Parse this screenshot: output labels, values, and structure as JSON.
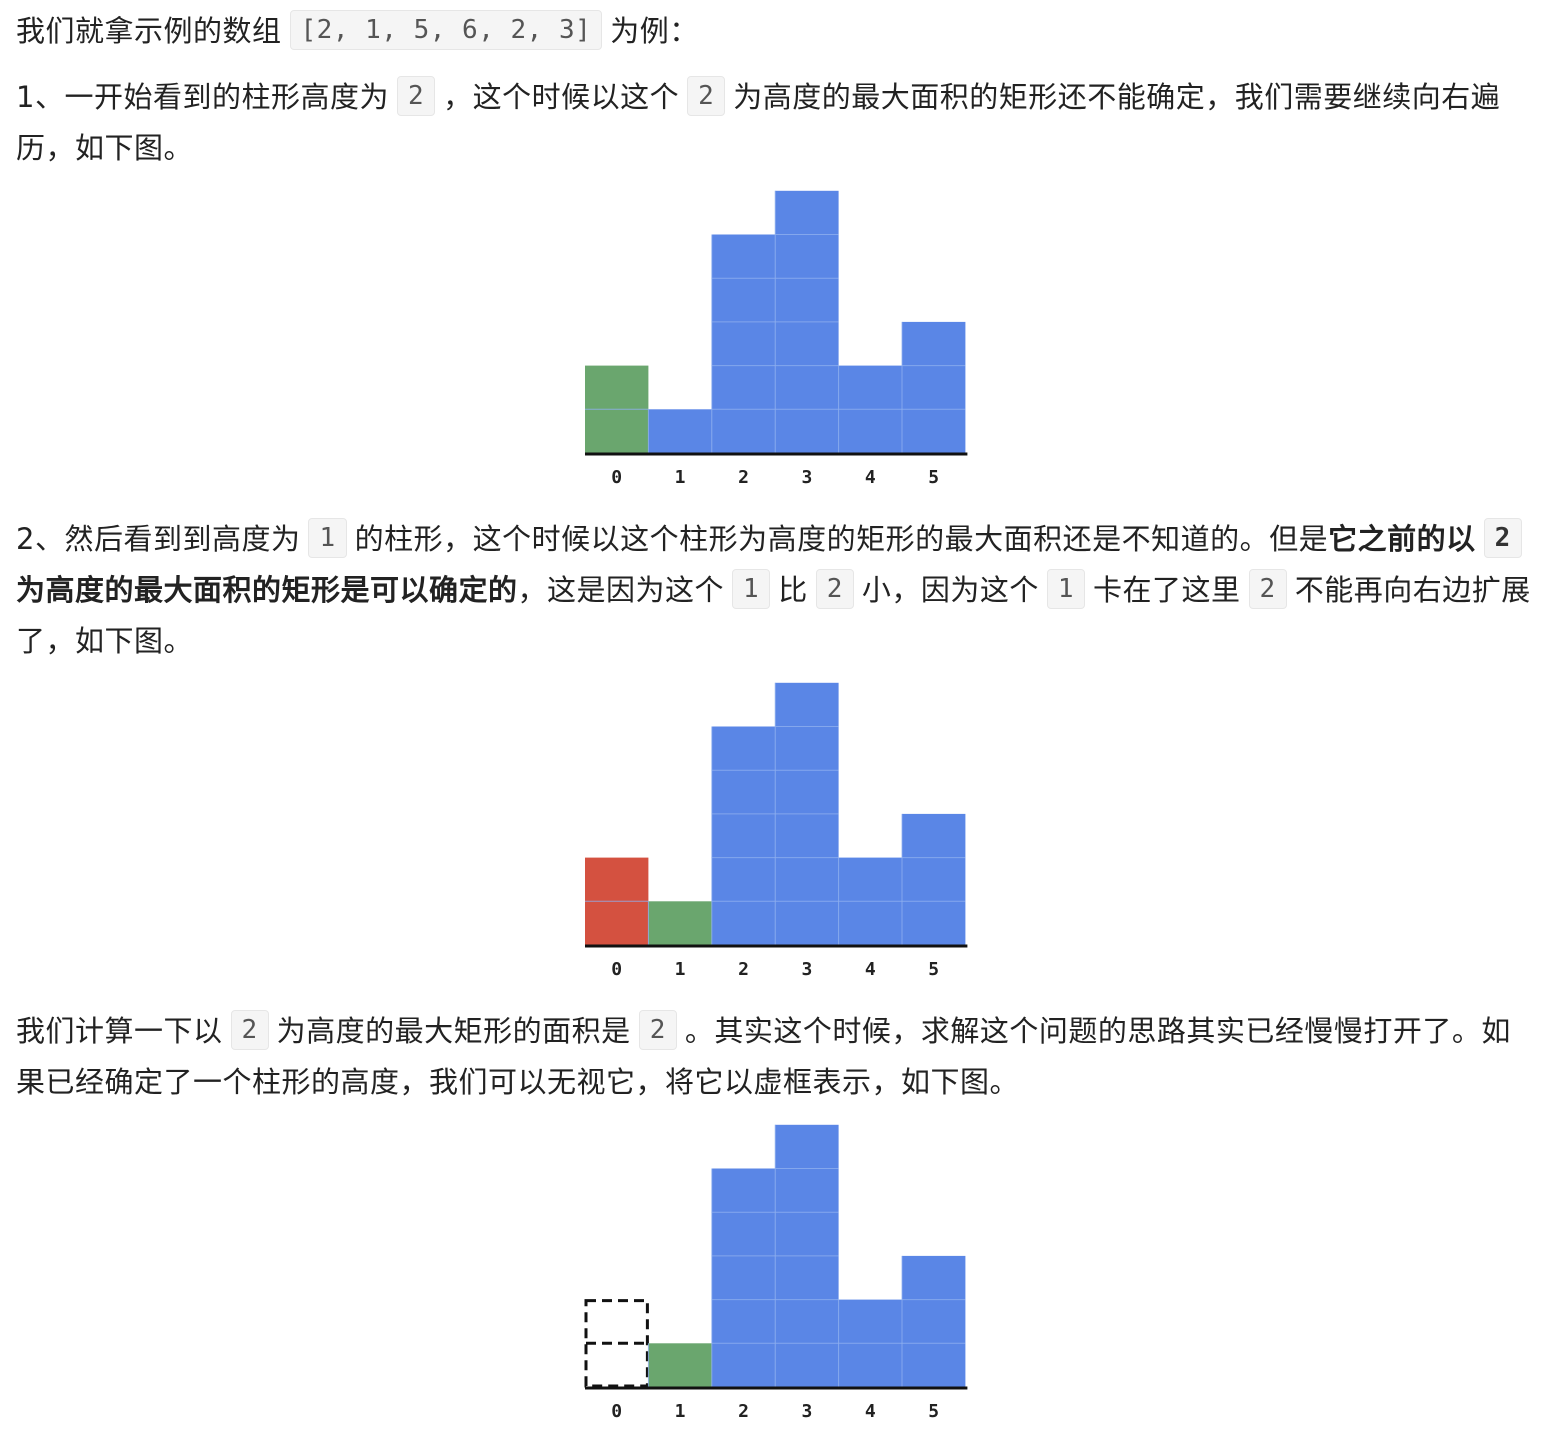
{
  "intro": {
    "text_before": "我们就拿示例的数组",
    "array": "[2, 1, 5, 6, 2, 3]",
    "text_after": "为例："
  },
  "step1": {
    "t1": "1、一开始看到的柱形高度为",
    "c1": "2",
    "t2": "，这个时候以这个",
    "c2": "2",
    "t3": "为高度的最大面积的矩形还不能确定，我们需要继续向右遍历，如下图。"
  },
  "step2": {
    "t1": "2、然后看到到高度为",
    "c1": "1",
    "t2": "的柱形，这个时候以这个柱形为高度的矩形的最大面积还是不知道的。但是",
    "b1": "它之前的以",
    "c2": "2",
    "b2": "为高度的最大面积的矩形是可以确定的",
    "t3": "，这是因为这个",
    "c3": "1",
    "t4": "比",
    "c4": "2",
    "t5": "小，因为这个",
    "c5": "1",
    "t6": "卡在了这里",
    "c6": "2",
    "t7": "不能再向右边扩展了，如下图。"
  },
  "step3": {
    "t1": "我们计算一下以",
    "c1": "2",
    "t2": "为高度的最大矩形的面积是",
    "c2": "2",
    "t3": "。其实这个时候，求解这个问题的思路其实已经慢慢打开了。如果已经确定了一个柱形的高度，我们可以无视它，将它以虚框表示，如下图。"
  },
  "colors": {
    "blue": "#5a86e6",
    "green": "#6aa66e",
    "red": "#d45140",
    "axis": "#111111",
    "grid": "#8fb0ef"
  },
  "chart_data": [
    {
      "type": "bar",
      "categories": [
        "0",
        "1",
        "2",
        "3",
        "4",
        "5"
      ],
      "values": [
        2,
        1,
        5,
        6,
        2,
        3
      ],
      "bar_states": [
        "green",
        "blue",
        "blue",
        "blue",
        "blue",
        "blue"
      ]
    },
    {
      "type": "bar",
      "categories": [
        "0",
        "1",
        "2",
        "3",
        "4",
        "5"
      ],
      "values": [
        2,
        1,
        5,
        6,
        2,
        3
      ],
      "bar_states": [
        "red",
        "green",
        "blue",
        "blue",
        "blue",
        "blue"
      ]
    },
    {
      "type": "bar",
      "categories": [
        "0",
        "1",
        "2",
        "3",
        "4",
        "5"
      ],
      "values": [
        2,
        1,
        5,
        6,
        2,
        3
      ],
      "bar_states": [
        "dashed",
        "green",
        "blue",
        "blue",
        "blue",
        "blue"
      ]
    }
  ]
}
